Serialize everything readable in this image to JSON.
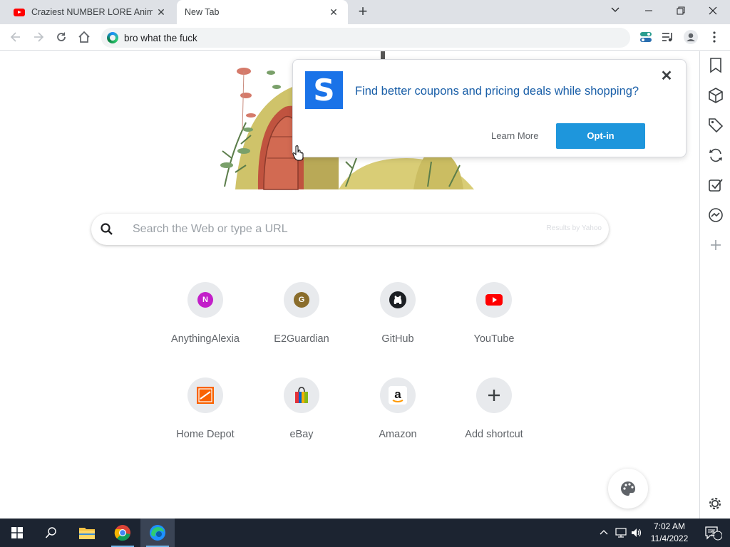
{
  "browser": {
    "tabs": [
      {
        "title": "Craziest NUMBER LORE Animatic",
        "icon": "youtube-icon",
        "active": false
      },
      {
        "title": "New Tab",
        "icon": "",
        "active": true
      }
    ],
    "address_bar": {
      "value": "bro what the fuck"
    }
  },
  "new_tab": {
    "search": {
      "placeholder": "Search the Web or type a URL",
      "results_by": "Results by Yahoo"
    },
    "shortcuts": [
      {
        "label": "AnythingAlexia",
        "icon_text": "N",
        "color": "#c21fc9"
      },
      {
        "label": "E2Guardian",
        "icon_text": "G",
        "color": "#8a6d2c"
      },
      {
        "label": "GitHub",
        "icon": "github-icon"
      },
      {
        "label": "YouTube",
        "icon": "youtube-icon"
      },
      {
        "label": "Home Depot",
        "icon": "home-depot-icon"
      },
      {
        "label": "eBay",
        "icon": "ebay-icon"
      },
      {
        "label": "Amazon",
        "icon": "amazon-icon"
      },
      {
        "label": "Add shortcut",
        "icon": "plus-icon"
      }
    ]
  },
  "popup": {
    "message": "Find better coupons and pricing deals while shopping?",
    "learn_more": "Learn More",
    "opt_in": "Opt-in",
    "logo_letter": "S"
  },
  "taskbar": {
    "time": "7:02 AM",
    "date": "11/4/2022",
    "notifications": "2"
  },
  "colors": {
    "accent": "#1e96dc",
    "popup_text": "#1a5fa8",
    "taskbar": "#1c2431"
  }
}
